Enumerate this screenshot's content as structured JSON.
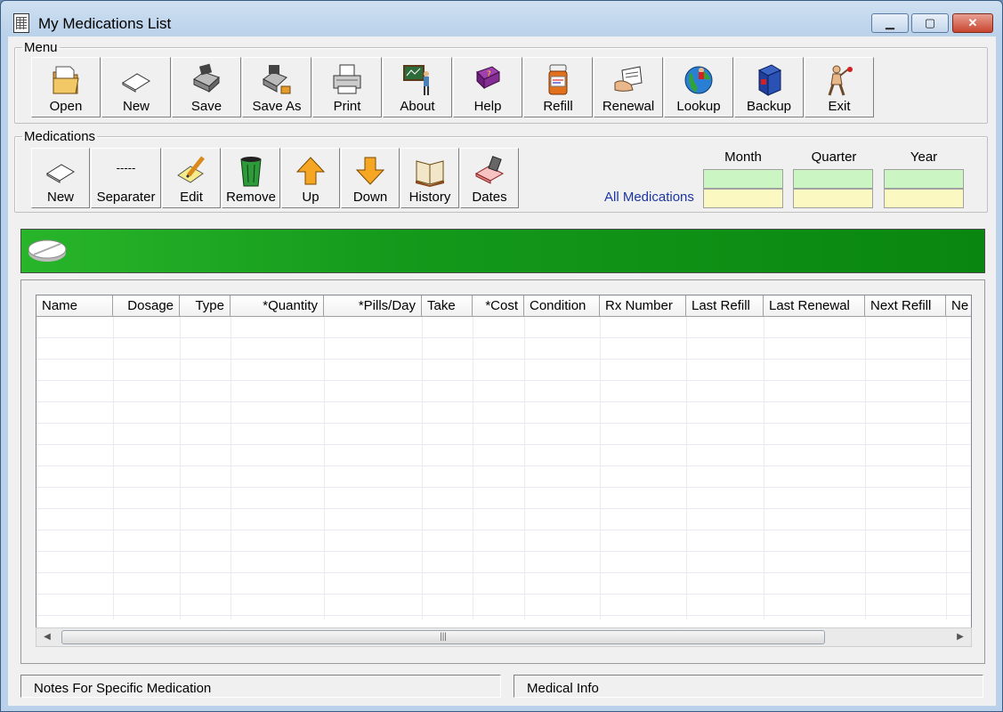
{
  "window": {
    "title": "My Medications List"
  },
  "menu": {
    "legend": "Menu",
    "buttons": [
      {
        "label": "Open",
        "icon": "folder-icon"
      },
      {
        "label": "New",
        "icon": "blank-page-icon"
      },
      {
        "label": "Save",
        "icon": "disk-save-icon"
      },
      {
        "label": "Save As",
        "icon": "disk-save-as-icon"
      },
      {
        "label": "Print",
        "icon": "printer-icon"
      },
      {
        "label": "About",
        "icon": "teacher-board-icon"
      },
      {
        "label": "Help",
        "icon": "help-book-icon"
      },
      {
        "label": "Refill",
        "icon": "pill-bottle-icon"
      },
      {
        "label": "Renewal",
        "icon": "prescription-hand-icon"
      },
      {
        "label": "Lookup",
        "icon": "globe-icon"
      },
      {
        "label": "Backup",
        "icon": "backup-book-icon"
      },
      {
        "label": "Exit",
        "icon": "walking-man-icon"
      }
    ]
  },
  "medications": {
    "legend": "Medications",
    "buttons": [
      {
        "label": "New",
        "icon": "blank-page-icon"
      },
      {
        "label": "Separater",
        "icon": "separator-icon",
        "glyph": "-----"
      },
      {
        "label": "Edit",
        "icon": "pencil-note-icon"
      },
      {
        "label": "Remove",
        "icon": "trash-can-icon"
      },
      {
        "label": "Up",
        "icon": "arrow-up-icon"
      },
      {
        "label": "Down",
        "icon": "arrow-down-icon"
      },
      {
        "label": "History",
        "icon": "open-book-icon"
      },
      {
        "label": "Dates",
        "icon": "calendar-stamp-icon"
      }
    ],
    "all_medications_label": "All Medications",
    "summary_headers": [
      "Month",
      "Quarter",
      "Year"
    ]
  },
  "table": {
    "columns": [
      "Name",
      "Dosage",
      "Type",
      "*Quantity",
      "*Pills/Day",
      "Take",
      "*Cost",
      "Condition",
      "Rx Number",
      "Last Refill",
      "Last Renewal",
      "Next Refill",
      "Ne"
    ],
    "rows": []
  },
  "status": {
    "notes_label": "Notes For Specific Medication",
    "medical_info_label": "Medical Info"
  },
  "colors": {
    "banner_green": "#14991b",
    "summary_green": "#ccf5c4",
    "summary_yellow": "#fbf8c2",
    "link_blue": "#1c35a6"
  }
}
